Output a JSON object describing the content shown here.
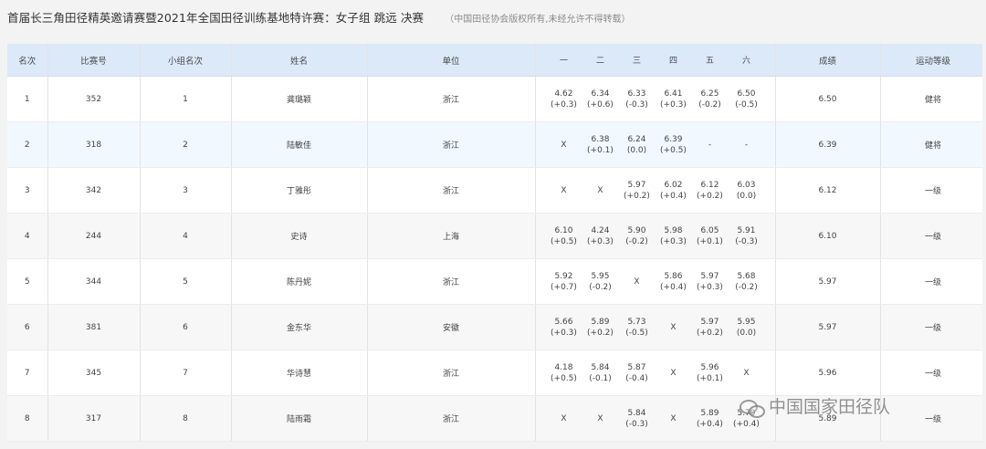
{
  "page": {
    "title": "首届长三角田径精英邀请赛暨2021年全国田径训练基地特许赛：女子组 跳远 决赛",
    "copyright": "（中国田径协会版权所有,未经允许不得转载）"
  },
  "table": {
    "headers": {
      "rank": "名次",
      "bib": "比赛号",
      "group_rank": "小组名次",
      "name": "姓名",
      "unit": "单位",
      "rounds": [
        "一",
        "二",
        "三",
        "四",
        "五",
        "六"
      ],
      "score": "成绩",
      "level": "运动等级"
    },
    "rows": [
      {
        "rank": "1",
        "bib": "352",
        "group_rank": "1",
        "name": "龚璐颖",
        "unit": "浙江",
        "attempts": [
          {
            "mark": "4.62",
            "wind": "(+0.3)"
          },
          {
            "mark": "6.34",
            "wind": "(+0.6)"
          },
          {
            "mark": "6.33",
            "wind": "(-0.3)"
          },
          {
            "mark": "6.41",
            "wind": "(+0.3)"
          },
          {
            "mark": "6.25",
            "wind": "(-0.2)"
          },
          {
            "mark": "6.50",
            "wind": "(-0.5)"
          }
        ],
        "score": "6.50",
        "level": "健将"
      },
      {
        "rank": "2",
        "bib": "318",
        "group_rank": "2",
        "name": "陆敏佳",
        "unit": "浙江",
        "attempts": [
          {
            "mark": "X",
            "wind": ""
          },
          {
            "mark": "6.38",
            "wind": "(+0.1)"
          },
          {
            "mark": "6.24",
            "wind": "(0.0)"
          },
          {
            "mark": "6.39",
            "wind": "(+0.5)"
          },
          {
            "mark": "-",
            "wind": ""
          },
          {
            "mark": "-",
            "wind": ""
          }
        ],
        "score": "6.39",
        "level": "健将"
      },
      {
        "rank": "3",
        "bib": "342",
        "group_rank": "3",
        "name": "丁雅彤",
        "unit": "浙江",
        "attempts": [
          {
            "mark": "X",
            "wind": ""
          },
          {
            "mark": "X",
            "wind": ""
          },
          {
            "mark": "5.97",
            "wind": "(+0.2)"
          },
          {
            "mark": "6.02",
            "wind": "(+0.4)"
          },
          {
            "mark": "6.12",
            "wind": "(+0.2)"
          },
          {
            "mark": "6.03",
            "wind": "(0.0)"
          }
        ],
        "score": "6.12",
        "level": "一级"
      },
      {
        "rank": "4",
        "bib": "244",
        "group_rank": "4",
        "name": "史诗",
        "unit": "上海",
        "attempts": [
          {
            "mark": "6.10",
            "wind": "(+0.5)"
          },
          {
            "mark": "4.24",
            "wind": "(+0.3)"
          },
          {
            "mark": "5.90",
            "wind": "(-0.2)"
          },
          {
            "mark": "5.98",
            "wind": "(+0.3)"
          },
          {
            "mark": "6.05",
            "wind": "(+0.1)"
          },
          {
            "mark": "5.91",
            "wind": "(-0.3)"
          }
        ],
        "score": "6.10",
        "level": "一级"
      },
      {
        "rank": "5",
        "bib": "344",
        "group_rank": "5",
        "name": "陈丹妮",
        "unit": "浙江",
        "attempts": [
          {
            "mark": "5.92",
            "wind": "(+0.7)"
          },
          {
            "mark": "5.95",
            "wind": "(-0.2)"
          },
          {
            "mark": "X",
            "wind": ""
          },
          {
            "mark": "5.86",
            "wind": "(+0.4)"
          },
          {
            "mark": "5.97",
            "wind": "(+0.3)"
          },
          {
            "mark": "5.68",
            "wind": "(-0.2)"
          }
        ],
        "score": "5.97",
        "level": "一级"
      },
      {
        "rank": "6",
        "bib": "381",
        "group_rank": "6",
        "name": "金东华",
        "unit": "安徽",
        "attempts": [
          {
            "mark": "5.66",
            "wind": "(+0.3)"
          },
          {
            "mark": "5.89",
            "wind": "(+0.2)"
          },
          {
            "mark": "5.73",
            "wind": "(-0.5)"
          },
          {
            "mark": "X",
            "wind": ""
          },
          {
            "mark": "5.97",
            "wind": "(+0.2)"
          },
          {
            "mark": "5.95",
            "wind": "(0.0)"
          }
        ],
        "score": "5.97",
        "level": "一级"
      },
      {
        "rank": "7",
        "bib": "345",
        "group_rank": "7",
        "name": "华诗慧",
        "unit": "浙江",
        "attempts": [
          {
            "mark": "4.18",
            "wind": "(+0.5)"
          },
          {
            "mark": "5.84",
            "wind": "(-0.1)"
          },
          {
            "mark": "5.87",
            "wind": "(-0.4)"
          },
          {
            "mark": "X",
            "wind": ""
          },
          {
            "mark": "5.96",
            "wind": "(+0.1)"
          },
          {
            "mark": "X",
            "wind": ""
          }
        ],
        "score": "5.96",
        "level": "一级"
      },
      {
        "rank": "8",
        "bib": "317",
        "group_rank": "8",
        "name": "陆雨霜",
        "unit": "浙江",
        "attempts": [
          {
            "mark": "X",
            "wind": ""
          },
          {
            "mark": "X",
            "wind": ""
          },
          {
            "mark": "5.84",
            "wind": "(-0.3)"
          },
          {
            "mark": "X",
            "wind": ""
          },
          {
            "mark": "5.89",
            "wind": "(+0.4)"
          },
          {
            "mark": "5.79",
            "wind": "(+0.4)"
          }
        ],
        "score": "5.89",
        "level": "一级"
      }
    ]
  },
  "watermark": {
    "icon": "wechat-icon",
    "text": "中国国家田径队"
  },
  "colors": {
    "header_background": "#dce9f8",
    "page_background": "#f3f3f3",
    "row_highlight": "#f2f8ff"
  }
}
